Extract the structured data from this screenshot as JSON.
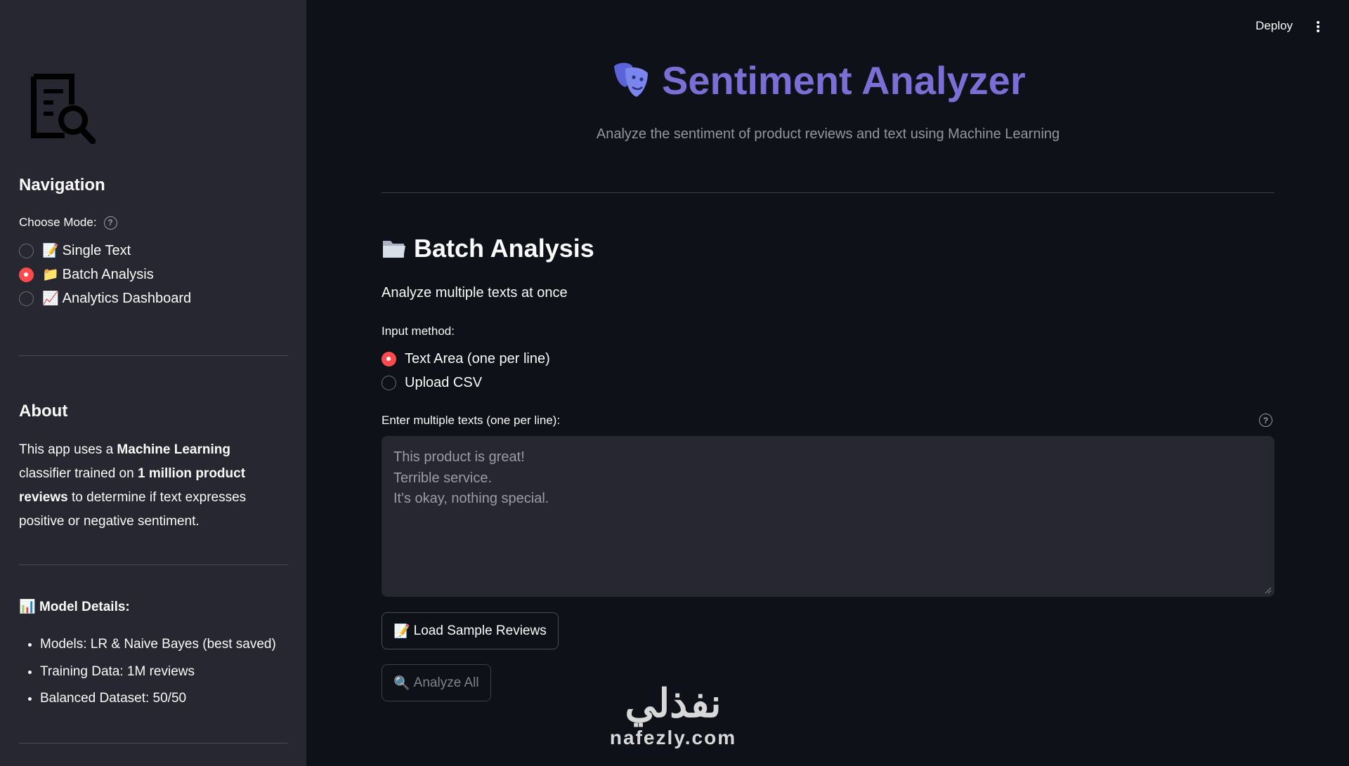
{
  "header": {
    "deploy_label": "Deploy",
    "menu_icon": "kebab-menu-icon"
  },
  "sidebar": {
    "logo_icon": "document-search-icon",
    "nav_heading": "Navigation",
    "choose_mode_label": "Choose Mode:",
    "modes": [
      {
        "emoji": "📝",
        "label": "Single Text",
        "selected": false
      },
      {
        "emoji": "📁",
        "label": "Batch Analysis",
        "selected": true
      },
      {
        "emoji": "📈",
        "label": "Analytics Dashboard",
        "selected": false
      }
    ],
    "about_heading": "About",
    "about": {
      "p1": "This app uses a ",
      "b1": "Machine Learning",
      "p2": " classifier trained on ",
      "b2": "1 million product reviews",
      "p3": " to determine if text expresses positive or negative sentiment."
    },
    "model_details_emoji": "📊",
    "model_details_title": "Model Details:",
    "model_details": [
      "Models: LR & Naive Bayes (best saved)",
      "Training Data: 1M reviews",
      "Balanced Dataset: 50/50"
    ]
  },
  "main": {
    "title_icon": "masks-icon",
    "title": "Sentiment Analyzer",
    "subtitle": "Analyze the sentiment of product reviews and text using Machine Learning",
    "section_icon": "folder-icon",
    "section_title": "Batch Analysis",
    "section_desc": "Analyze multiple texts at once",
    "input_method_label": "Input method:",
    "input_methods": [
      {
        "label": "Text Area (one per line)",
        "selected": true
      },
      {
        "label": "Upload CSV",
        "selected": false
      }
    ],
    "textarea_label": "Enter multiple texts (one per line):",
    "textarea_placeholder": "This product is great!\nTerrible service.\nIt's okay, nothing special.",
    "load_sample_emoji": "📝",
    "load_sample_label": "Load Sample Reviews",
    "analyze_emoji": "🔍",
    "analyze_label": "Analyze All"
  },
  "watermark": {
    "arabic": "نفذلي",
    "latin": "nafezly.com"
  },
  "colors": {
    "accent": "#ff4b4b",
    "title": "#7b6fd6",
    "background": "#0e1117",
    "sidebar": "#262730"
  }
}
